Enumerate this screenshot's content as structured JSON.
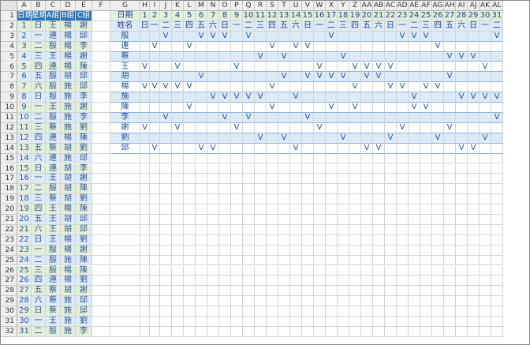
{
  "columns": [
    "A",
    "B",
    "C",
    "D",
    "E",
    "F",
    "G",
    "H",
    "I",
    "J",
    "K",
    "L",
    "M",
    "N",
    "O",
    "P",
    "Q",
    "R",
    "S",
    "T",
    "U",
    "V",
    "W",
    "X",
    "Y",
    "Z",
    "AA",
    "AB",
    "AC",
    "AD",
    "AE",
    "AF",
    "AG",
    "AH",
    "AI",
    "AJ",
    "AK",
    "AL"
  ],
  "rows": [
    "1",
    "2",
    "3",
    "4",
    "5",
    "6",
    "7",
    "8",
    "9",
    "10",
    "11",
    "12",
    "13",
    "14",
    "15",
    "16",
    "17",
    "18",
    "19",
    "20",
    "21",
    "22",
    "23",
    "24",
    "25",
    "26",
    "27",
    "28",
    "29",
    "30",
    "31",
    "32"
  ],
  "left_table": {
    "headers": [
      "日期",
      "星期",
      "A組",
      "B組",
      "C組"
    ],
    "data": [
      [
        "1",
        "日",
        "王",
        "楊",
        "謝"
      ],
      [
        "2",
        "一",
        "連",
        "楊",
        "邱"
      ],
      [
        "3",
        "二",
        "殷",
        "楊",
        "李"
      ],
      [
        "4",
        "三",
        "王",
        "楊",
        "謝"
      ],
      [
        "5",
        "四",
        "連",
        "楊",
        "陳"
      ],
      [
        "6",
        "五",
        "殷",
        "胡",
        "邱"
      ],
      [
        "7",
        "六",
        "殷",
        "施",
        "邱"
      ],
      [
        "8",
        "日",
        "殷",
        "施",
        "李"
      ],
      [
        "9",
        "一",
        "王",
        "施",
        "謝"
      ],
      [
        "10",
        "二",
        "殷",
        "施",
        "李"
      ],
      [
        "11",
        "三",
        "蔡",
        "施",
        "劉"
      ],
      [
        "12",
        "四",
        "連",
        "楊",
        "陳"
      ],
      [
        "13",
        "五",
        "蔡",
        "胡",
        "劉"
      ],
      [
        "14",
        "六",
        "連",
        "施",
        "邱"
      ],
      [
        "15",
        "日",
        "連",
        "胡",
        "李"
      ],
      [
        "16",
        "一",
        "王",
        "胡",
        "謝"
      ],
      [
        "17",
        "二",
        "殷",
        "胡",
        "陳"
      ],
      [
        "18",
        "三",
        "蔡",
        "胡",
        "劉"
      ],
      [
        "19",
        "四",
        "王",
        "楊",
        "陳"
      ],
      [
        "20",
        "五",
        "王",
        "胡",
        "邱"
      ],
      [
        "21",
        "六",
        "王",
        "胡",
        "邱"
      ],
      [
        "22",
        "日",
        "王",
        "楊",
        "劉"
      ],
      [
        "23",
        "一",
        "殷",
        "楊",
        "謝"
      ],
      [
        "24",
        "二",
        "殷",
        "施",
        "陳"
      ],
      [
        "25",
        "三",
        "殷",
        "楊",
        "陳"
      ],
      [
        "26",
        "四",
        "連",
        "楊",
        "劉"
      ],
      [
        "27",
        "五",
        "蔡",
        "胡",
        "謝"
      ],
      [
        "28",
        "六",
        "蔡",
        "施",
        "邱"
      ],
      [
        "29",
        "日",
        "蔡",
        "施",
        "邱"
      ],
      [
        "30",
        "一",
        "王",
        "施",
        "劉"
      ],
      [
        "31",
        "二",
        "殷",
        "施",
        "李"
      ]
    ]
  },
  "right_table": {
    "title_label": "日期",
    "name_label": "姓名",
    "days": [
      "1",
      "2",
      "3",
      "4",
      "5",
      "6",
      "7",
      "8",
      "9",
      "10",
      "11",
      "12",
      "13",
      "14",
      "15",
      "16",
      "17",
      "18",
      "19",
      "20",
      "21",
      "22",
      "23",
      "24",
      "25",
      "26",
      "27",
      "28",
      "29",
      "30",
      "31"
    ],
    "weekdays": [
      "日",
      "一",
      "二",
      "三",
      "四",
      "五",
      "六",
      "日",
      "一",
      "二",
      "三",
      "四",
      "五",
      "六",
      "日",
      "一",
      "二",
      "三",
      "四",
      "五",
      "六",
      "日",
      "一",
      "二",
      "三",
      "四",
      "五",
      "六",
      "日",
      "一",
      "二"
    ],
    "mark": "V",
    "people": [
      {
        "name": "殷",
        "marks": [
          3,
          6,
          7,
          8,
          10,
          17,
          23,
          24,
          25,
          31
        ]
      },
      {
        "name": "連",
        "marks": [
          2,
          5,
          12,
          14,
          15,
          26
        ]
      },
      {
        "name": "蔡",
        "marks": [
          11,
          13,
          18,
          27,
          28,
          29
        ]
      },
      {
        "name": "王",
        "marks": [
          1,
          4,
          9,
          16,
          19,
          20,
          21,
          22,
          30
        ]
      },
      {
        "name": "胡",
        "marks": [
          6,
          13,
          15,
          16,
          17,
          18,
          20,
          21,
          27
        ]
      },
      {
        "name": "楊",
        "marks": [
          1,
          2,
          3,
          4,
          5,
          12,
          19,
          22,
          23,
          25,
          26
        ]
      },
      {
        "name": "施",
        "marks": [
          7,
          8,
          9,
          10,
          11,
          14,
          24,
          28,
          29,
          30,
          31
        ]
      },
      {
        "name": "陳",
        "marks": [
          5,
          12,
          17,
          19,
          24,
          25
        ]
      },
      {
        "name": "李",
        "marks": [
          3,
          8,
          10,
          15,
          31
        ]
      },
      {
        "name": "謝",
        "marks": [
          1,
          4,
          9,
          16,
          23,
          27
        ]
      },
      {
        "name": "劉",
        "marks": [
          11,
          13,
          18,
          22,
          26,
          30
        ]
      },
      {
        "name": "邱",
        "marks": [
          2,
          6,
          7,
          14,
          20,
          21,
          28,
          29
        ]
      }
    ]
  }
}
